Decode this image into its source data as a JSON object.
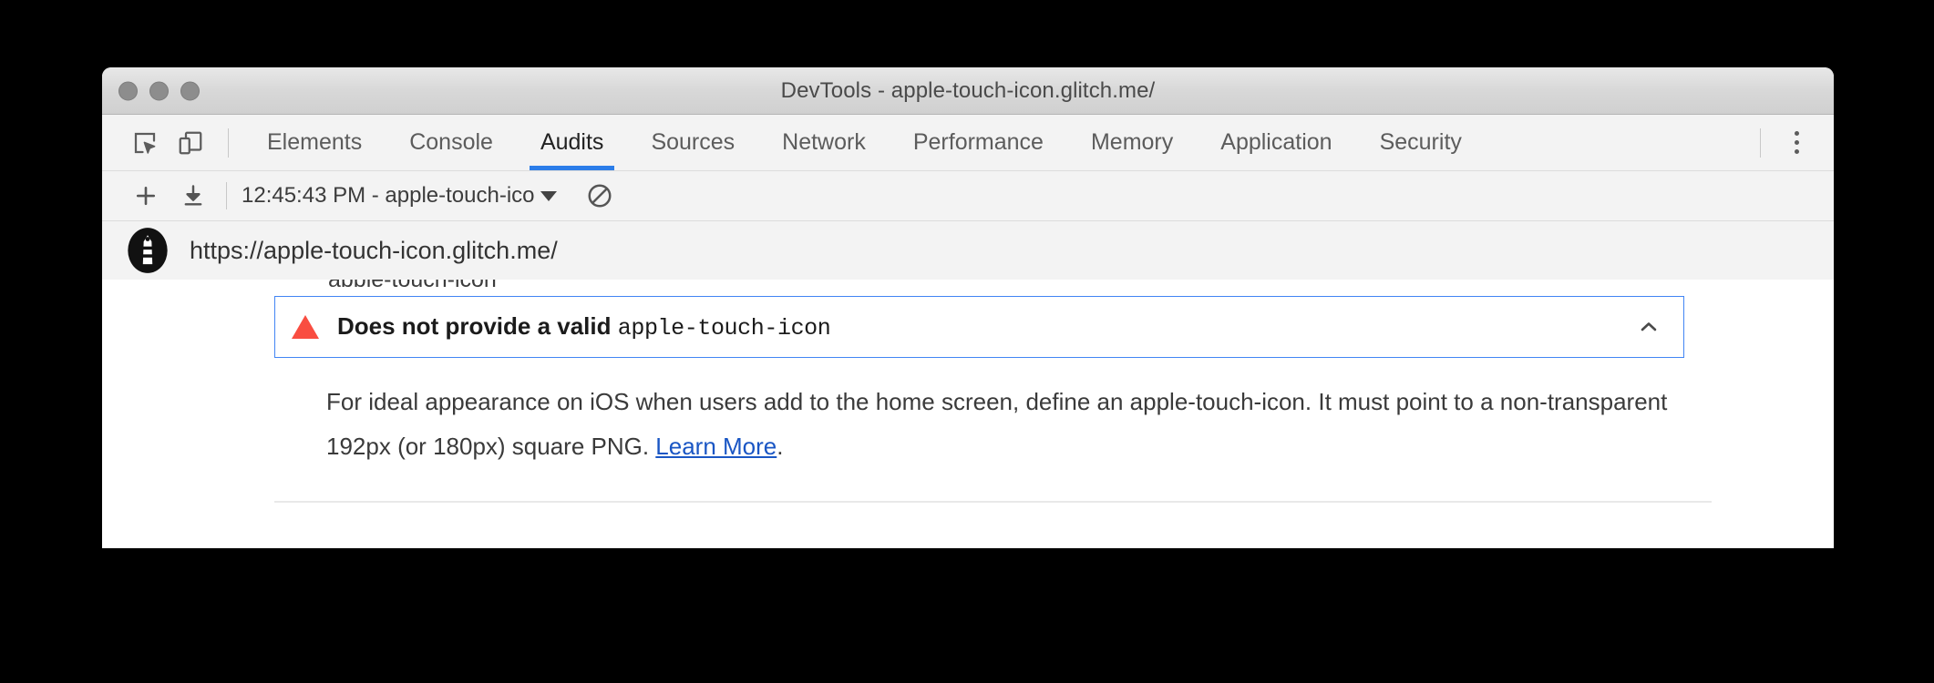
{
  "window": {
    "title": "DevTools - apple-touch-icon.glitch.me/",
    "traffic_lights": [
      "close",
      "minimize",
      "maximize"
    ]
  },
  "tabbar": {
    "left_icons": [
      {
        "name": "inspect-element-icon",
        "label": "Inspect element"
      },
      {
        "name": "device-toolbar-icon",
        "label": "Toggle device toolbar"
      }
    ],
    "tabs": [
      {
        "label": "Elements",
        "active": false
      },
      {
        "label": "Console",
        "active": false
      },
      {
        "label": "Audits",
        "active": true
      },
      {
        "label": "Sources",
        "active": false
      },
      {
        "label": "Network",
        "active": false
      },
      {
        "label": "Performance",
        "active": false
      },
      {
        "label": "Memory",
        "active": false
      },
      {
        "label": "Application",
        "active": false
      },
      {
        "label": "Security",
        "active": false
      }
    ],
    "menu_icon": "kebab-menu-icon",
    "active_underline_color": "#2b7de9"
  },
  "audit_toolbar": {
    "add_icon": "plus-icon",
    "download_icon": "download-icon",
    "run_selector_value": "12:45:43 PM - apple-touch-ico",
    "dropdown_icon": "chevron-down-icon",
    "clear_icon": "clear-all-icon"
  },
  "url_row": {
    "logo": "lighthouse-logo-icon",
    "url": "https://apple-touch-icon.glitch.me/"
  },
  "report": {
    "clipped_text_above": "apple-touch-icon",
    "audit": {
      "status_icon": "warning-triangle-icon",
      "status_color": "#f94d41",
      "title_text": "Does not provide a valid ",
      "title_code": "apple-touch-icon",
      "expand_icon": "chevron-up-icon",
      "description_before": "For ideal appearance on iOS when users add to the home screen, define an apple-touch-icon. It must point to a non-transparent 192px (or 180px) square PNG. ",
      "link_text": "Learn More",
      "description_after": ".",
      "link_color": "#1a56c4"
    }
  }
}
